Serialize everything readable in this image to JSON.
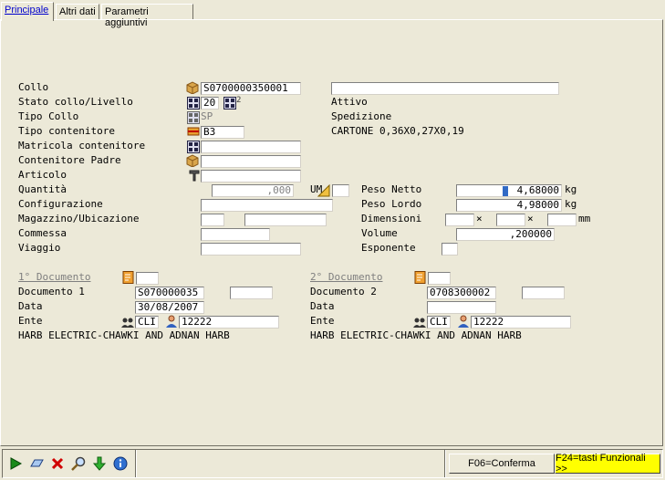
{
  "tabs": [
    "Principale",
    "Altri dati",
    "Parametri aggiuntivi"
  ],
  "labels": {
    "collo": "Collo",
    "stato": "Stato collo/Livello",
    "tipo_collo": "Tipo Collo",
    "tipo_contenitore": "Tipo contenitore",
    "matricola": "Matricola contenitore",
    "padre": "Contenitore Padre",
    "articolo": "Articolo",
    "quantita": "Quantità",
    "configurazione": "Configurazione",
    "magazzino": "Magazzino/Ubicazione",
    "commessa": "Commessa",
    "viaggio": "Viaggio",
    "peso_netto": "Peso Netto",
    "peso_lordo": "Peso Lordo",
    "dimensioni": "Dimensioni",
    "volume": "Volume",
    "esponente": "Esponente",
    "um": "UM",
    "kg1": "kg",
    "kg2": "kg",
    "mm": "mm",
    "x1": "×",
    "x2": "×"
  },
  "values": {
    "collo": "S0700000350001",
    "stato": "20",
    "livello": "2",
    "stato_desc": "Attivo",
    "tipo_collo": "SP",
    "tipo_collo_desc": "Spedizione",
    "tipo_contenitore": "B3",
    "tipo_contenitore_desc": "CARTONE 0,36X0,27X0,19",
    "quantita": ",000",
    "peso_netto": "4,68000",
    "peso_lordo": "4,98000",
    "volume": ",200000"
  },
  "doc1": {
    "title": "1° Documento",
    "doc_label": "Documento 1",
    "doc_value": "S070000035",
    "data_label": "Data",
    "data_value": "30/08/2007",
    "ente_label": "Ente",
    "ente_type": "CLI",
    "ente_code": "12222",
    "ente_name": "HARB ELECTRIC-CHAWKI AND ADNAN HARB"
  },
  "doc2": {
    "title": "2° Documento",
    "doc_label": "Documento 2",
    "doc_value": "0708300002",
    "data_label": "Data",
    "data_value": "",
    "ente_label": "Ente",
    "ente_type": "CLI",
    "ente_code": "12222",
    "ente_name": "HARB ELECTRIC-CHAWKI AND ADNAN HARB"
  },
  "buttons": {
    "conferma": "F06=Conferma",
    "funzionali": "F24=tasti Funzionali >>"
  },
  "colors": {
    "link": "#0000cc",
    "f24_bg": "#ffff00",
    "window_bg": "#ece9d8"
  }
}
